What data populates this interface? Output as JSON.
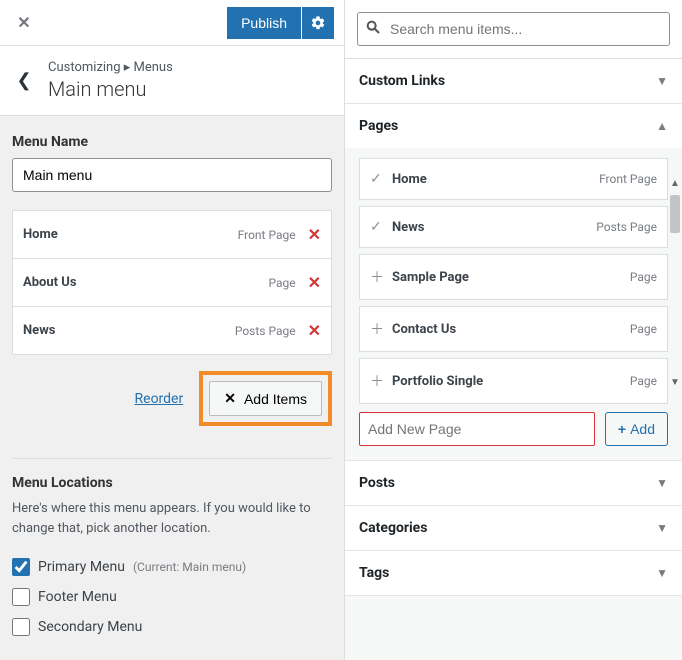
{
  "header": {
    "publish_label": "Publish"
  },
  "nav": {
    "breadcrumb": "Customizing ▸ Menus",
    "title": "Main menu"
  },
  "menu_name": {
    "label": "Menu Name",
    "value": "Main menu"
  },
  "menu_items": [
    {
      "title": "Home",
      "type": "Front Page"
    },
    {
      "title": "About Us",
      "type": "Page"
    },
    {
      "title": "News",
      "type": "Posts Page"
    }
  ],
  "actions": {
    "reorder": "Reorder",
    "add_items": "Add Items"
  },
  "locations": {
    "heading": "Menu Locations",
    "description": "Here's where this menu appears. If you would like to change that, pick another location.",
    "items": [
      {
        "label": "Primary Menu",
        "checked": true,
        "extra": "(Current: Main menu)"
      },
      {
        "label": "Footer Menu",
        "checked": false,
        "extra": ""
      },
      {
        "label": "Secondary Menu",
        "checked": false,
        "extra": ""
      }
    ]
  },
  "search": {
    "placeholder": "Search menu items..."
  },
  "accordion": {
    "custom_links": "Custom Links",
    "pages": "Pages",
    "posts": "Posts",
    "categories": "Categories",
    "tags": "Tags"
  },
  "pages_list": [
    {
      "title": "Home",
      "type": "Front Page",
      "added": true
    },
    {
      "title": "News",
      "type": "Posts Page",
      "added": true
    },
    {
      "title": "Sample Page",
      "type": "Page",
      "added": false
    },
    {
      "title": "Contact Us",
      "type": "Page",
      "added": false
    },
    {
      "title": "Portfolio Single",
      "type": "Page",
      "added": false
    }
  ],
  "add_page": {
    "placeholder": "Add New Page",
    "button": "Add"
  }
}
